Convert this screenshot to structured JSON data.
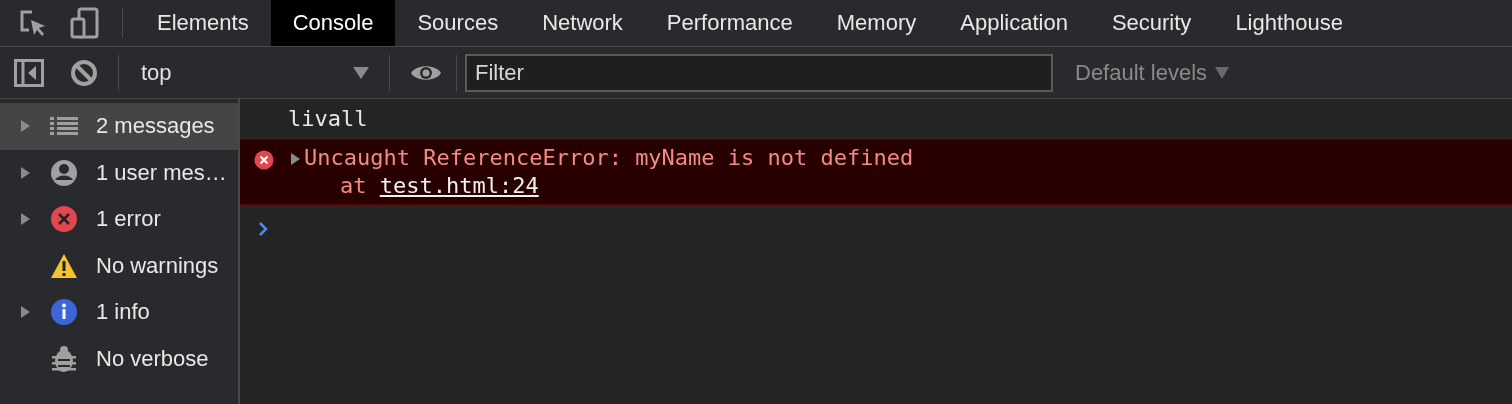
{
  "tabs": [
    {
      "label": "Elements",
      "selected": false
    },
    {
      "label": "Console",
      "selected": true
    },
    {
      "label": "Sources",
      "selected": false
    },
    {
      "label": "Network",
      "selected": false
    },
    {
      "label": "Performance",
      "selected": false
    },
    {
      "label": "Memory",
      "selected": false
    },
    {
      "label": "Application",
      "selected": false
    },
    {
      "label": "Security",
      "selected": false
    },
    {
      "label": "Lighthouse",
      "selected": false
    }
  ],
  "toolbar": {
    "context": "top",
    "filter_placeholder": "Filter",
    "levels": "Default levels"
  },
  "sidebar": [
    {
      "kind": "messages",
      "label": "2 messages",
      "expandable": true,
      "selected": true
    },
    {
      "kind": "user",
      "label": "1 user mes…",
      "expandable": true,
      "selected": false
    },
    {
      "kind": "error",
      "label": "1 error",
      "expandable": true,
      "selected": false
    },
    {
      "kind": "warning",
      "label": "No warnings",
      "expandable": false,
      "selected": false
    },
    {
      "kind": "info",
      "label": "1 info",
      "expandable": true,
      "selected": false
    },
    {
      "kind": "verbose",
      "label": "No verbose",
      "expandable": false,
      "selected": false
    }
  ],
  "messages": [
    {
      "kind": "log",
      "text": "livall"
    },
    {
      "kind": "error",
      "text": "Uncaught ReferenceError: myName is not defined",
      "expanded": false,
      "stack_prefix": "at",
      "link": "test.html:24"
    }
  ]
}
